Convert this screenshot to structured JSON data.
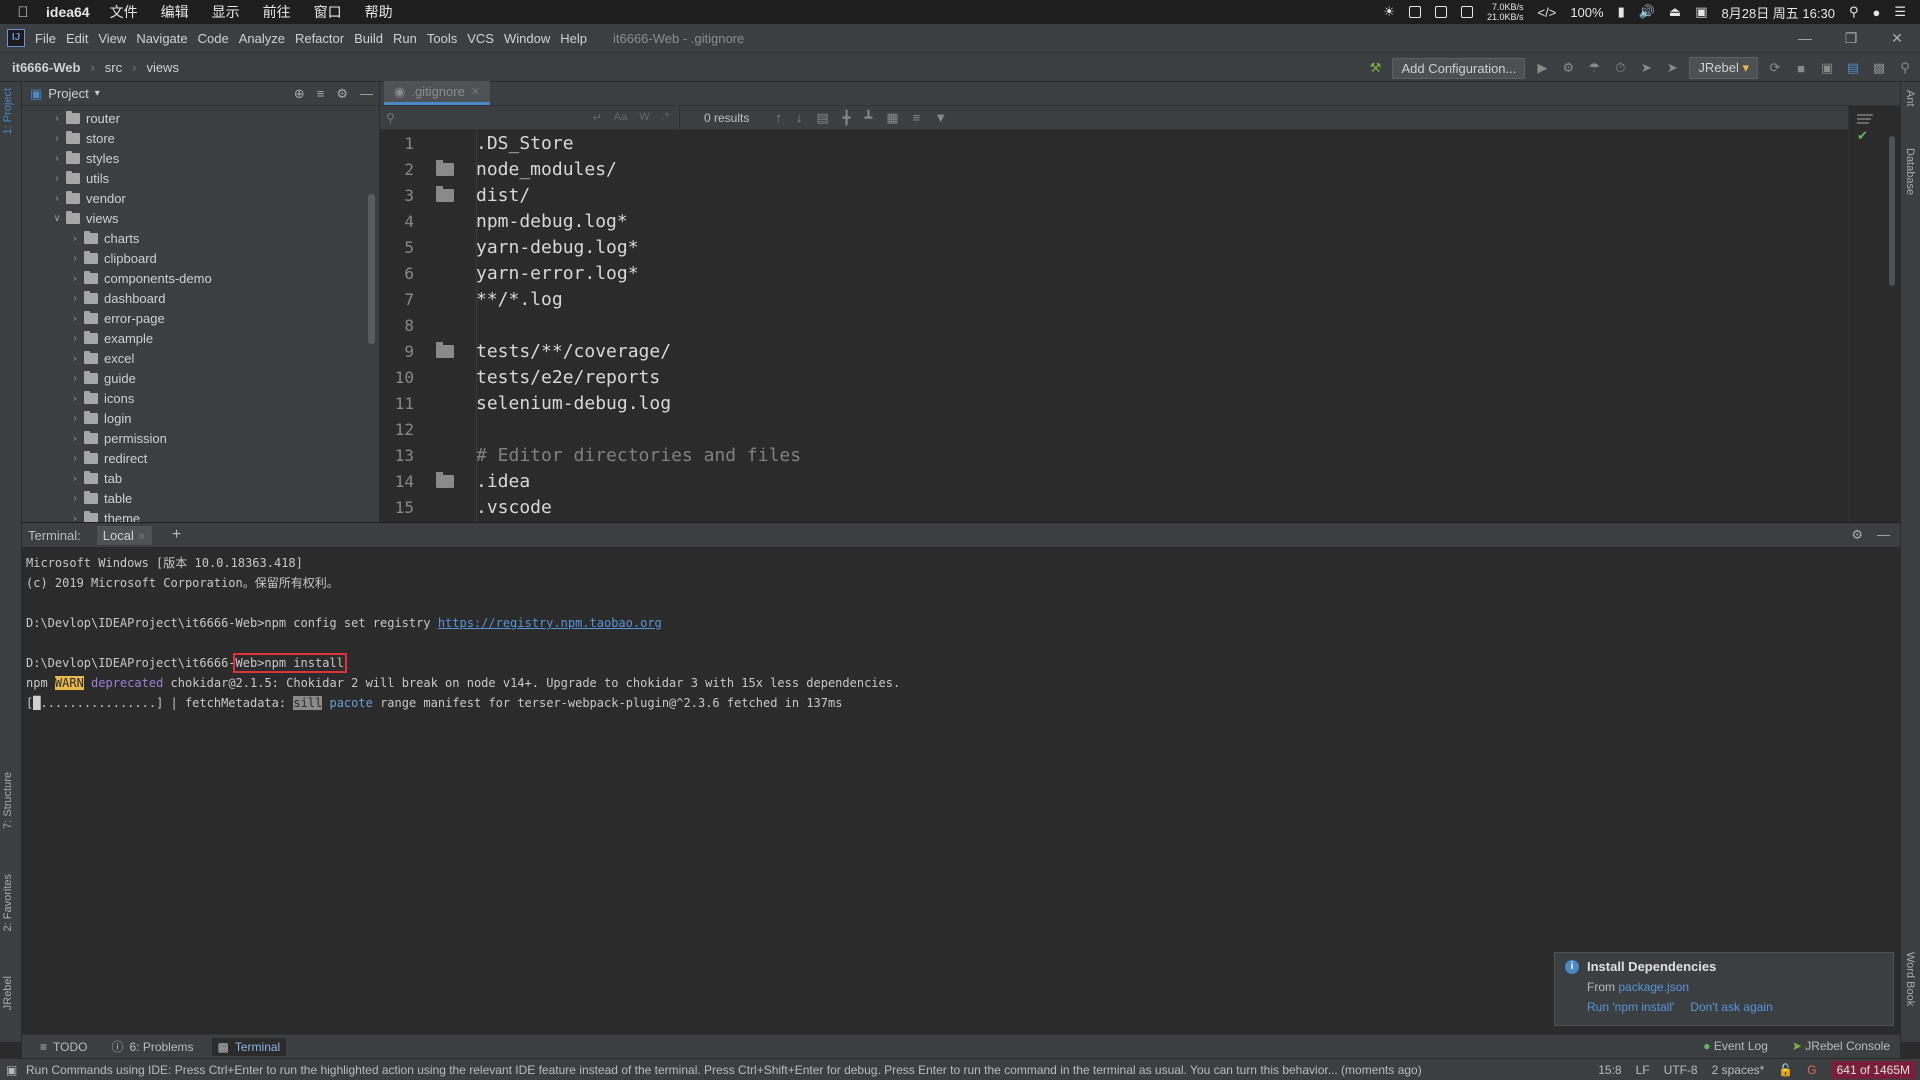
{
  "mac_menubar": {
    "app_name": "idea64",
    "items": [
      "文件",
      "编辑",
      "显示",
      "前往",
      "窗口",
      "帮助"
    ],
    "net_up": "7.0KB/s",
    "net_down": "21.0KB/s",
    "battery": "100%",
    "datetime": "8月28日 周五 16:30"
  },
  "ide_menu": {
    "items": [
      "File",
      "Edit",
      "View",
      "Navigate",
      "Code",
      "Analyze",
      "Refactor",
      "Build",
      "Run",
      "Tools",
      "VCS",
      "Window",
      "Help"
    ],
    "window_title": "it6666-Web - .gitignore"
  },
  "navbar": {
    "project": "it6666-Web",
    "crumbs": [
      "src",
      "views"
    ],
    "add_configuration": "Add Configuration...",
    "jrebel": "JRebel"
  },
  "left_strip": {
    "project": "1: Project",
    "structure": "7: Structure",
    "favorites": "2: Favorites",
    "jrebel": "JRebel"
  },
  "right_strip": {
    "ant": "Ant",
    "database": "Database",
    "wordbook": "Word Book"
  },
  "project_panel": {
    "title": "Project",
    "tree": [
      {
        "name": "router",
        "level": 1,
        "expanded": false
      },
      {
        "name": "store",
        "level": 1,
        "expanded": false
      },
      {
        "name": "styles",
        "level": 1,
        "expanded": false
      },
      {
        "name": "utils",
        "level": 1,
        "expanded": false
      },
      {
        "name": "vendor",
        "level": 1,
        "expanded": false
      },
      {
        "name": "views",
        "level": 1,
        "expanded": true
      },
      {
        "name": "charts",
        "level": 2,
        "expanded": false
      },
      {
        "name": "clipboard",
        "level": 2,
        "expanded": false
      },
      {
        "name": "components-demo",
        "level": 2,
        "expanded": false
      },
      {
        "name": "dashboard",
        "level": 2,
        "expanded": false
      },
      {
        "name": "error-page",
        "level": 2,
        "expanded": false
      },
      {
        "name": "example",
        "level": 2,
        "expanded": false
      },
      {
        "name": "excel",
        "level": 2,
        "expanded": false
      },
      {
        "name": "guide",
        "level": 2,
        "expanded": false
      },
      {
        "name": "icons",
        "level": 2,
        "expanded": false
      },
      {
        "name": "login",
        "level": 2,
        "expanded": false
      },
      {
        "name": "permission",
        "level": 2,
        "expanded": false
      },
      {
        "name": "redirect",
        "level": 2,
        "expanded": false
      },
      {
        "name": "tab",
        "level": 2,
        "expanded": false
      },
      {
        "name": "table",
        "level": 2,
        "expanded": false
      },
      {
        "name": "theme",
        "level": 2,
        "expanded": false
      }
    ]
  },
  "editor": {
    "tab_name": ".gitignore",
    "find_results": "0 results",
    "find_options": [
      "Aa",
      "W",
      ".*"
    ],
    "lines": [
      {
        "num": "1",
        "text": ".DS_Store",
        "fold": false,
        "comment": false
      },
      {
        "num": "2",
        "text": "node_modules/",
        "fold": true,
        "comment": false
      },
      {
        "num": "3",
        "text": "dist/",
        "fold": true,
        "comment": false
      },
      {
        "num": "4",
        "text": "npm-debug.log*",
        "fold": false,
        "comment": false
      },
      {
        "num": "5",
        "text": "yarn-debug.log*",
        "fold": false,
        "comment": false
      },
      {
        "num": "6",
        "text": "yarn-error.log*",
        "fold": false,
        "comment": false
      },
      {
        "num": "7",
        "text": "**/*.log",
        "fold": false,
        "comment": false
      },
      {
        "num": "8",
        "text": "",
        "fold": false,
        "comment": false
      },
      {
        "num": "9",
        "text": "tests/**/coverage/",
        "fold": true,
        "comment": false
      },
      {
        "num": "10",
        "text": "tests/e2e/reports",
        "fold": false,
        "comment": false
      },
      {
        "num": "11",
        "text": "selenium-debug.log",
        "fold": false,
        "comment": false
      },
      {
        "num": "12",
        "text": "",
        "fold": false,
        "comment": false
      },
      {
        "num": "13",
        "text": "# Editor directories and files",
        "fold": false,
        "comment": true
      },
      {
        "num": "14",
        "text": ".idea",
        "fold": true,
        "comment": false
      },
      {
        "num": "15",
        "text": ".vscode",
        "fold": false,
        "comment": false
      }
    ]
  },
  "terminal": {
    "label": "Terminal:",
    "tab": "Local",
    "line1": "Microsoft Windows [版本 10.0.18363.418]",
    "line2": "(c) 2019 Microsoft Corporation。保留所有权利。",
    "line3_prefix": "D:\\Devlop\\IDEAProject\\it6666-Web>npm config set registry ",
    "line3_link": "https://registry.npm.taobao.org",
    "line4_prefix": "D:\\Devlop\\IDEAProject\\it6666-",
    "line4_cmd": "Web>npm install",
    "line5_npm": "npm ",
    "line5_warn": "WARN",
    "line5_dep": "deprecated",
    "line5_rest": " chokidar@2.1.5: Chokidar 2 will break on node v14+. Upgrade to chokidar 3 with 15x less dependencies.",
    "line6_pre": "[",
    "line6_progress": "................] | fetchMetadata: ",
    "line6_sill": "sill",
    "line6_pacote": "pacote",
    "line6_rest": " range manifest for terser-webpack-plugin@^2.3.6 fetched in 137ms"
  },
  "notification": {
    "title": "Install Dependencies",
    "from": "From ",
    "from_link": "package.json",
    "action1": "Run 'npm install'",
    "action2": "Don't ask again"
  },
  "bottom_tools": {
    "todo": "TODO",
    "problems": "6: Problems",
    "terminal": "Terminal",
    "event_log": "Event Log",
    "jrebel_console": "JRebel Console"
  },
  "statusbar": {
    "message": "Run Commands using IDE: Press Ctrl+Enter to run the highlighted action using the relevant IDE feature instead of the terminal. Press Ctrl+Shift+Enter for debug. Press Enter to run the command in the terminal as usual. You can turn this behavior... (moments ago)",
    "position": "15:8",
    "line_sep": "LF",
    "encoding": "UTF-8",
    "indent": "2 spaces*",
    "memory": "641 of 1465M"
  },
  "colors": {
    "accent": "#4a88c7",
    "link": "#5894d8",
    "warn": "#e8b84a",
    "highlight_box": "#e0313b"
  }
}
